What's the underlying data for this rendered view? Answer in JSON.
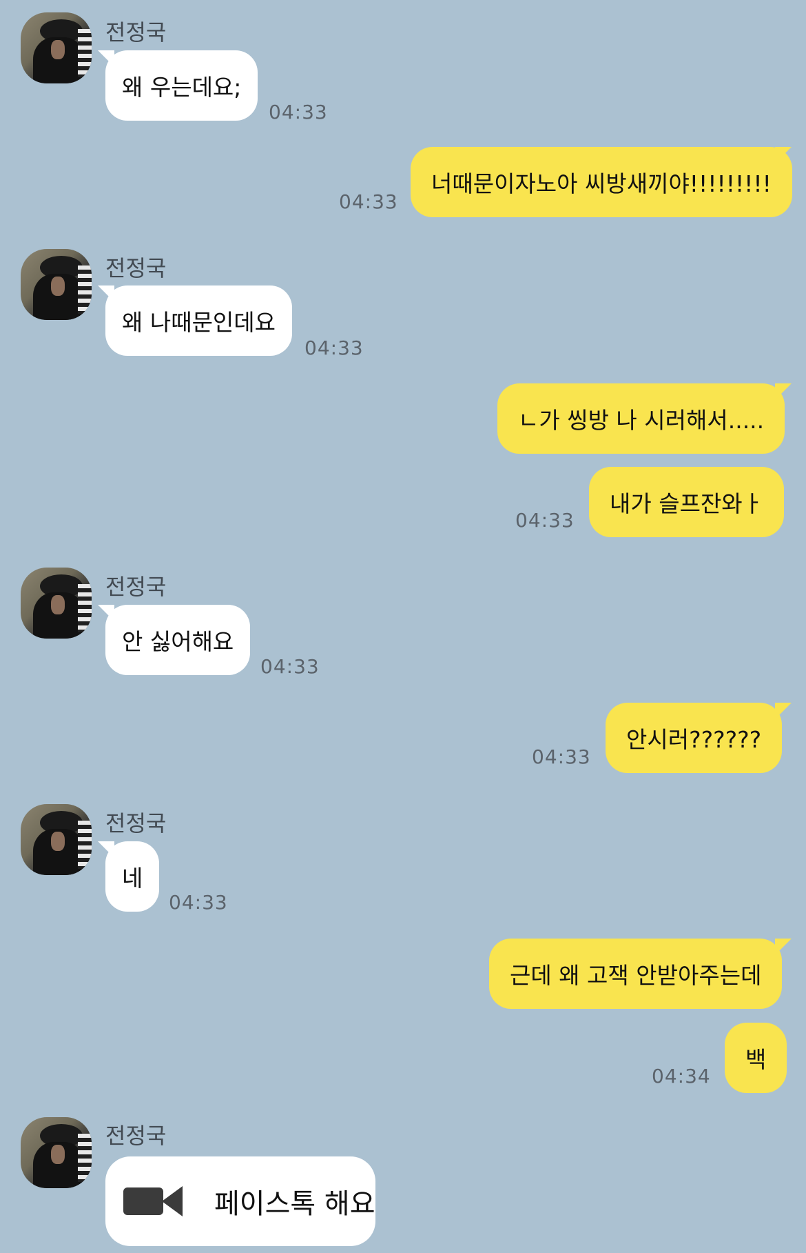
{
  "contact": {
    "name": "전정국"
  },
  "messages": [
    {
      "side": "in",
      "text": "왜 우는데요;",
      "time": "04:33"
    },
    {
      "side": "out",
      "text": "너때문이자노아 씨방새끼야!!!!!!!!!",
      "time": "04:33"
    },
    {
      "side": "in",
      "text": "왜 나때문인데요",
      "time": "04:33"
    },
    {
      "side": "out",
      "text": "ㄴ가 씽방 나 시러해서.....",
      "time": ""
    },
    {
      "side": "out",
      "text": "내가 슬프잔와ㅏ",
      "time": "04:33"
    },
    {
      "side": "in",
      "text": "안 싫어해요",
      "time": "04:33"
    },
    {
      "side": "out",
      "text": "안시러??????",
      "time": "04:33"
    },
    {
      "side": "in",
      "text": "네",
      "time": "04:33"
    },
    {
      "side": "out",
      "text": "근데 왜 고잭 안받아주는데",
      "time": ""
    },
    {
      "side": "out",
      "text": "백",
      "time": "04:34"
    },
    {
      "side": "in",
      "text": "페이스톡 해요",
      "time": "",
      "type": "facetalk",
      "icon": "video-camera-icon"
    }
  ]
}
